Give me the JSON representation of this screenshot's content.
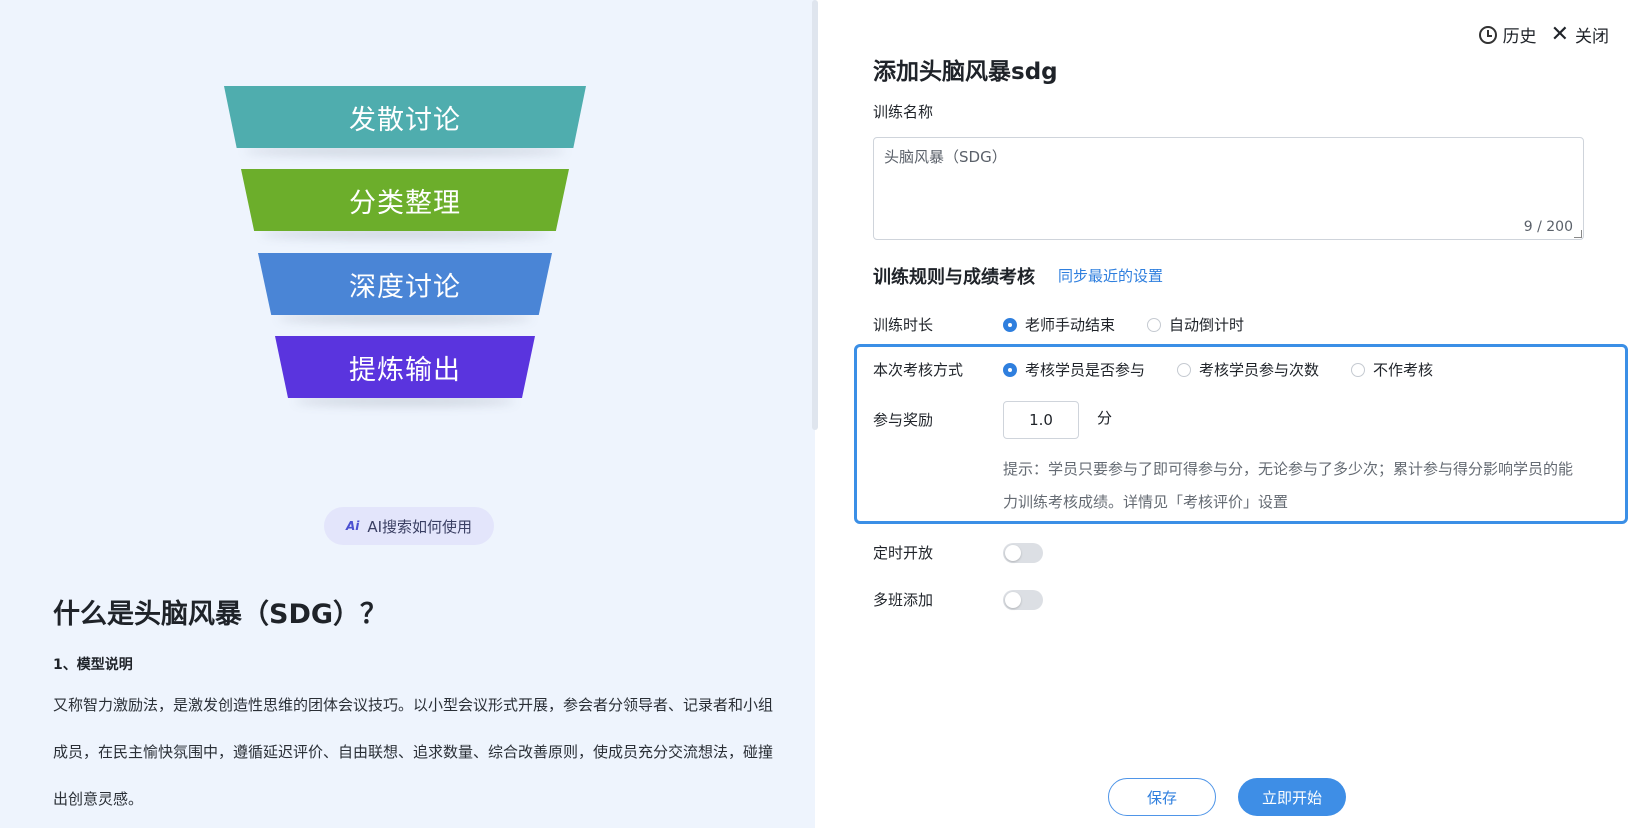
{
  "left": {
    "funnel": [
      "发散讨论",
      "分类整理",
      "深度讨论",
      "提炼输出"
    ],
    "ai_button": "AI搜索如何使用",
    "title": "什么是头脑风暴（SDG）？",
    "subtitle": "1、模型说明",
    "paragraph": "又称智力激励法，是激发创造性思维的团体会议技巧。以小型会议形式开展，参会者分领导者、记录者和小组成员，在民主愉快氛围中，遵循延迟评价、自由联想、追求数量、综合改善原则，使成员充分交流想法，碰撞出创意灵感。"
  },
  "right": {
    "actions": {
      "history": "历史",
      "close": "关闭"
    },
    "title": "添加头脑风暴sdg",
    "name_label": "训练名称",
    "name_value": "头脑风暴（SDG）",
    "name_count": "9 / 200",
    "section_title": "训练规则与成绩考核",
    "sync_link": "同步最近的设置",
    "duration": {
      "label": "训练时长",
      "options": [
        "老师手动结束",
        "自动倒计时"
      ],
      "selected": 0
    },
    "assess": {
      "label": "本次考核方式",
      "options": [
        "考核学员是否参与",
        "考核学员参与次数",
        "不作考核"
      ],
      "selected": 0
    },
    "reward": {
      "label": "参与奖励",
      "value": "1.0",
      "unit": "分",
      "hint": "提示：学员只要参与了即可得参与分，无论参与了多少次；累计参与得分影响学员的能力训练考核成绩。详情见「考核评价」设置"
    },
    "schedule": {
      "label": "定时开放",
      "on": false
    },
    "multi_class": {
      "label": "多班添加",
      "on": false
    },
    "buttons": {
      "save": "保存",
      "start": "立即开始"
    },
    "accent_color": "#2f7fde"
  }
}
